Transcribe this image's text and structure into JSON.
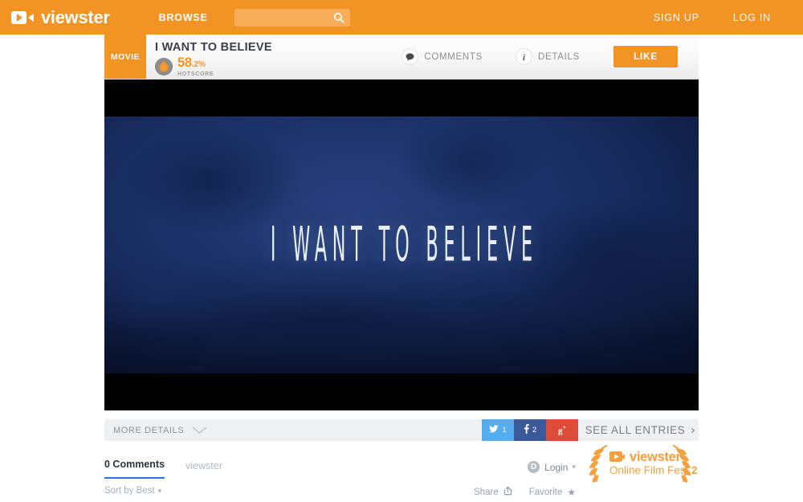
{
  "site": {
    "brand": "viewster",
    "logo_icon": "viewster-play-logo-icon"
  },
  "topnav": {
    "browse_label": "BROWSE",
    "search": {
      "value": "",
      "placeholder": "",
      "icon": "search-icon"
    },
    "signup_label": "SIGN UP",
    "login_label": "LOG IN",
    "background_color": "#f29423"
  },
  "titlebar": {
    "type_badge": "MOVIE",
    "title": "I WANT TO BELIEVE",
    "hotscore": {
      "value": "58",
      "fraction": ".2%",
      "label": "HOTSCORE",
      "icon": "flame-icon",
      "color": "#f29423"
    },
    "actions": [
      {
        "label": "COMMENTS",
        "icon": "speech-bubble-icon"
      },
      {
        "label": "DETAILS",
        "icon": "info-icon"
      }
    ],
    "like_label": "LIKE"
  },
  "player": {
    "film_title": "I WANT TO BELIEVE",
    "letterbox_color": "#000000",
    "film_background_color": "#1b3269"
  },
  "detailsbar": {
    "more_details_label": "MORE DETAILS",
    "chevron_icon": "chevron-down-icon",
    "social": [
      {
        "network": "twitter",
        "icon": "twitter-bird-icon",
        "count": "1",
        "color": "#55acee"
      },
      {
        "network": "facebook",
        "icon": "facebook-f-icon",
        "count": "2",
        "color": "#3b5998"
      },
      {
        "network": "google-plus",
        "icon": "google-plus-icon",
        "count": "",
        "color": "#dd4b39"
      }
    ],
    "see_all_label": "SEE ALL ENTRIES",
    "see_all_chevron": "›"
  },
  "comments": {
    "count_label": "0 Comments",
    "brand_label": "viewster",
    "login_label": "Login",
    "login_caret": "▾",
    "disqus_icon": "disqus-d-icon",
    "sort_label": "Sort by Best",
    "sort_caret": "▾",
    "share_label": "Share",
    "share_icon": "share-box-icon",
    "favorite_label": "Favorite",
    "favorite_icon": "star-icon",
    "active_tab_color": "#2e71e5"
  },
  "laurel_badge": {
    "brand": "viewster",
    "subtitle_prefix": "Online Film Fest",
    "subtitle_number": "2",
    "icon": "laurel-wreath-icon",
    "color": "#f5a03c"
  }
}
